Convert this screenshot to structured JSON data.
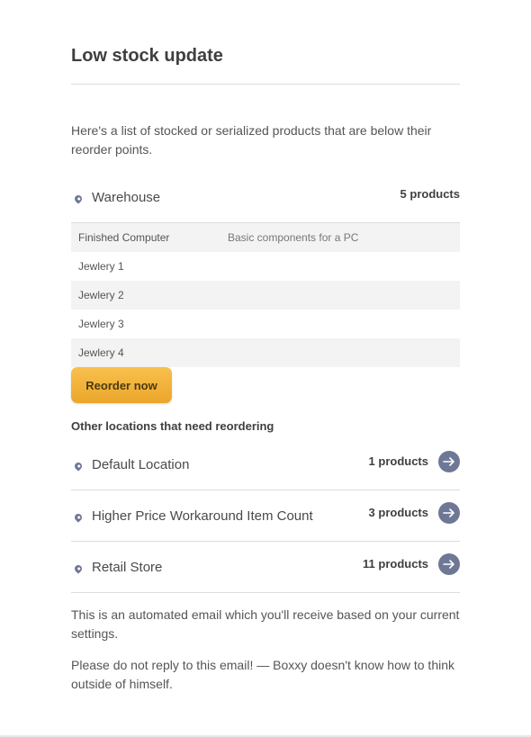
{
  "email": {
    "title": "Low stock update",
    "intro": "Here's a list of stocked or serialized products that are below their reorder points.",
    "primary_location": {
      "name": "Warehouse",
      "count": "5 products"
    },
    "products": [
      {
        "name": "Finished Computer",
        "description": "Basic components for a PC"
      },
      {
        "name": "Jewlery 1",
        "description": ""
      },
      {
        "name": "Jewlery 2",
        "description": ""
      },
      {
        "name": "Jewlery 3",
        "description": ""
      },
      {
        "name": "Jewlery 4",
        "description": ""
      }
    ],
    "reorder_button": "Reorder now",
    "other_title": "Other locations that need reordering",
    "other_locations": [
      {
        "name": "Default Location",
        "count": "1 products",
        "icon": "arrow-right-icon"
      },
      {
        "name": "Higher Price Workaround Item Count",
        "count": "3 products",
        "icon": "arrow-right-icon"
      },
      {
        "name": "Retail Store",
        "count": "11 products",
        "icon": "arrow-right-icon"
      }
    ],
    "footer_1": "This is an automated email which you'll receive based on your current settings.",
    "footer_2": "Please do not reply to this email! — Boxxy doesn't know how to think outside of himself.",
    "colors": {
      "accent": "#f2b33a",
      "icon": "#6e7896",
      "row_alt": "#f3f3f3"
    }
  }
}
